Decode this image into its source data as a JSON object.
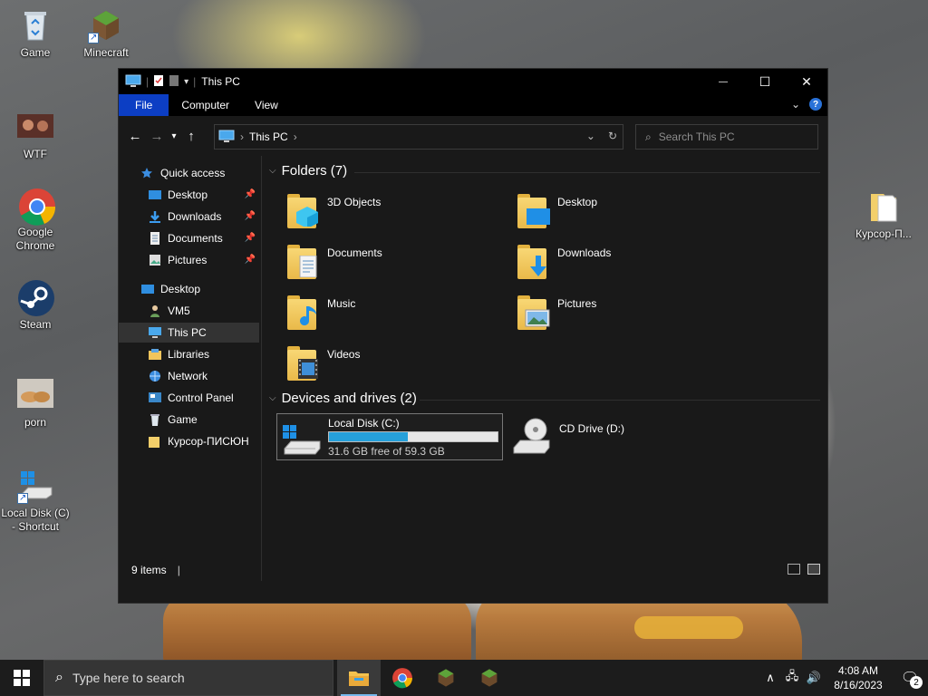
{
  "desktop": {
    "icons": [
      {
        "label": "Game",
        "icon": "recycle-bin-icon"
      },
      {
        "label": "Minecraft",
        "icon": "minecraft-icon"
      },
      {
        "label": "WTF",
        "icon": "image-thumbnail-icon"
      },
      {
        "label": "Google Chrome",
        "icon": "chrome-icon"
      },
      {
        "label": "Steam",
        "icon": "steam-icon"
      },
      {
        "label": "porn",
        "icon": "image-thumbnail-icon"
      },
      {
        "label": "Local Disk (C) - Shortcut",
        "icon": "drive-shortcut-icon"
      },
      {
        "label": "Курсор-П...",
        "icon": "document-icon"
      }
    ]
  },
  "window": {
    "title": "This PC",
    "ribbon_tabs": [
      "File",
      "Computer",
      "View"
    ],
    "controls": {
      "minimize": "—",
      "maximize": "☐",
      "close": "✕"
    },
    "address": {
      "crumb": "This PC"
    },
    "search_placeholder": "Search This PC",
    "sidebar": [
      {
        "label": "Quick access",
        "icon": "star-icon",
        "pinned": false
      },
      {
        "label": "Desktop",
        "icon": "desktop-icon",
        "pinned": true
      },
      {
        "label": "Downloads",
        "icon": "download-icon",
        "pinned": true
      },
      {
        "label": "Documents",
        "icon": "documents-icon",
        "pinned": true
      },
      {
        "label": "Pictures",
        "icon": "pictures-icon",
        "pinned": true
      },
      {
        "label": "Desktop",
        "icon": "desktop-icon",
        "pinned": false
      },
      {
        "label": "VM5",
        "icon": "user-icon",
        "pinned": false
      },
      {
        "label": "This PC",
        "icon": "computer-icon",
        "pinned": false,
        "selected": true
      },
      {
        "label": "Libraries",
        "icon": "libraries-icon",
        "pinned": false
      },
      {
        "label": "Network",
        "icon": "network-icon",
        "pinned": false
      },
      {
        "label": "Control Panel",
        "icon": "control-panel-icon",
        "pinned": false
      },
      {
        "label": "Game",
        "icon": "recycle-bin-icon",
        "pinned": false
      },
      {
        "label": "Курсор-ПИСЮН",
        "icon": "folder-icon",
        "pinned": false
      }
    ],
    "folders_header": "Folders (7)",
    "folders": [
      {
        "name": "3D Objects",
        "overlay": "cube"
      },
      {
        "name": "Desktop",
        "overlay": "monitor"
      },
      {
        "name": "Documents",
        "overlay": "doc"
      },
      {
        "name": "Downloads",
        "overlay": "arrow"
      },
      {
        "name": "Music",
        "overlay": "note"
      },
      {
        "name": "Pictures",
        "overlay": "photo"
      },
      {
        "name": "Videos",
        "overlay": "film"
      }
    ],
    "drives_header": "Devices and drives (2)",
    "drives": [
      {
        "name": "Local Disk (C:)",
        "free_text": "31.6 GB free of 59.3 GB",
        "used_fraction": 0.467
      },
      {
        "name": "CD Drive (D:)"
      }
    ],
    "status": "9 items"
  },
  "taskbar": {
    "search_placeholder": "Type here to search",
    "time": "4:08 AM",
    "date": "8/16/2023",
    "notifications": "2"
  },
  "colors": {
    "accent": "#0c3ec4",
    "drive_bar": "#26a0da",
    "window_bg": "#191919"
  }
}
